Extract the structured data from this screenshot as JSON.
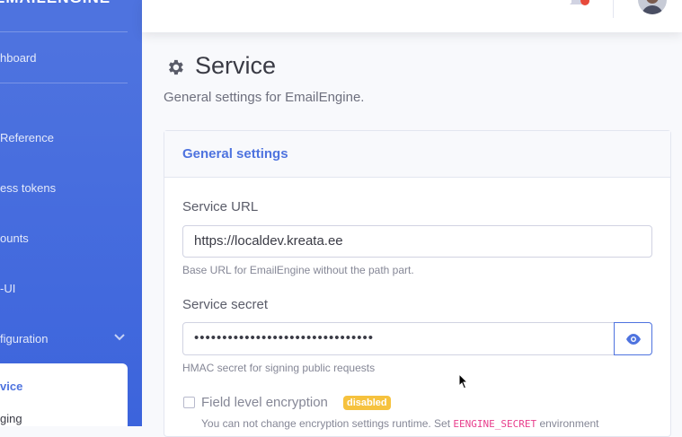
{
  "sidebar": {
    "brand": "EMAILENGINE",
    "items": [
      {
        "label": "hboard"
      },
      {
        "label": " Reference"
      },
      {
        "label": "ess tokens"
      },
      {
        "label": "ounts"
      },
      {
        "label": "-UI"
      },
      {
        "label": "figuration"
      }
    ],
    "submenu": [
      {
        "label": "vice"
      },
      {
        "label": "ging"
      }
    ]
  },
  "topbar": {
    "bell_icon": "bell-icon",
    "avatar": "user-avatar"
  },
  "page": {
    "title": "Service",
    "subtitle": "General settings for EmailEngine."
  },
  "card": {
    "title": "General settings",
    "service_url": {
      "label": "Service URL",
      "value": "https://localdev.kreata.ee",
      "help": "Base URL for EmailEngine without the path part."
    },
    "service_secret": {
      "label": "Service secret",
      "value": "••••••••••••••••••••••••••••••••",
      "help": "HMAC secret for signing public requests"
    },
    "encryption": {
      "label": "Field level encryption",
      "badge": "disabled",
      "note_prefix": "You can not change encryption settings runtime. Set ",
      "note_code": "EENGINE_SECRET",
      "note_suffix": " environment"
    }
  },
  "colors": {
    "primary": "#4e73df",
    "badge_warning": "#f6c23e",
    "notification": "#e74a3b"
  }
}
